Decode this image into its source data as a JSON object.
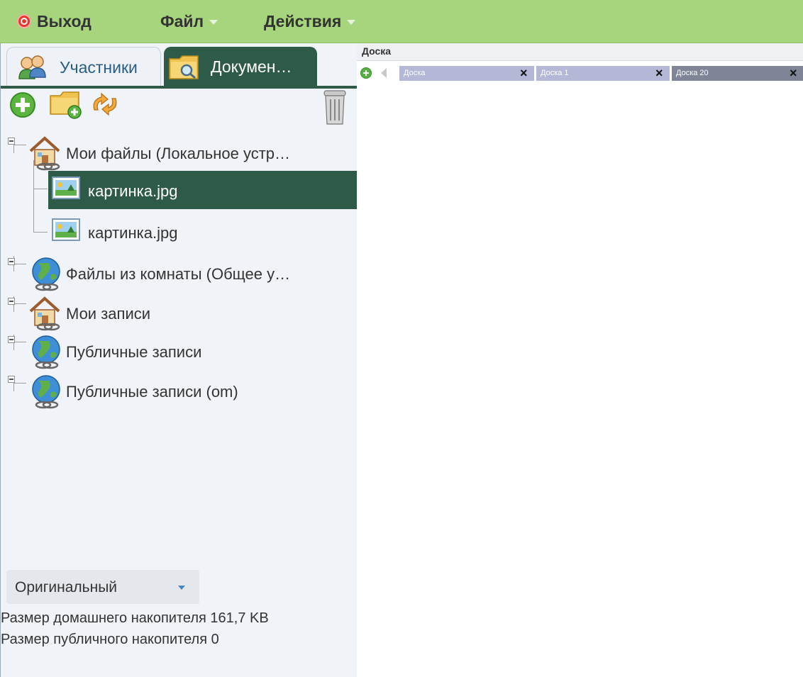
{
  "menubar": {
    "exit_label": "Выход",
    "file_label": "Файл",
    "actions_label": "Действия",
    "colors": {
      "background": "#a7d57d",
      "exit_icon": "#e8382e"
    }
  },
  "left_panel": {
    "tabs": [
      {
        "label": "Участники",
        "icon": "users-icon",
        "active": false
      },
      {
        "label": "Докумен…",
        "icon": "folder-search-icon",
        "active": true
      }
    ],
    "toolbar": [
      {
        "icon": "add-icon"
      },
      {
        "icon": "new-folder-icon"
      },
      {
        "icon": "refresh-icon"
      },
      {
        "icon": "trash-icon"
      }
    ],
    "tree": [
      {
        "label": "Мои файлы (Локальное устр…",
        "icon": "home-icon",
        "level": 0
      },
      {
        "label": "картинка.jpg",
        "icon": "image-icon",
        "level": 1,
        "selected": true
      },
      {
        "label": "картинка.jpg",
        "icon": "image-icon",
        "level": 1,
        "selected": false
      },
      {
        "label": "Файлы из комнаты (Общее у…",
        "icon": "globe-icon",
        "level": 0
      },
      {
        "label": "Мои записи",
        "icon": "home-icon",
        "level": 0
      },
      {
        "label": "Публичные записи",
        "icon": "globe-icon",
        "level": 0
      },
      {
        "label": "Публичные записи (om)",
        "icon": "globe-icon",
        "level": 0
      }
    ],
    "view_mode": {
      "selected": "Оригинальный"
    },
    "home_storage": "Размер домашнего накопителя 161,7 KB",
    "public_storage": "Размер публичного накопителя 0",
    "colors": {
      "selected_row": "#2d5b48",
      "panel_bg": "#f0f3f7"
    }
  },
  "board_area": {
    "header_label": "Доска",
    "tabs": [
      {
        "label": "Доска",
        "active": false
      },
      {
        "label": "Доска 1",
        "active": false
      },
      {
        "label": "Доска 20",
        "active": true
      }
    ],
    "colors": {
      "tab": "#b4b8d6",
      "active_tab": "#7f8496"
    }
  }
}
